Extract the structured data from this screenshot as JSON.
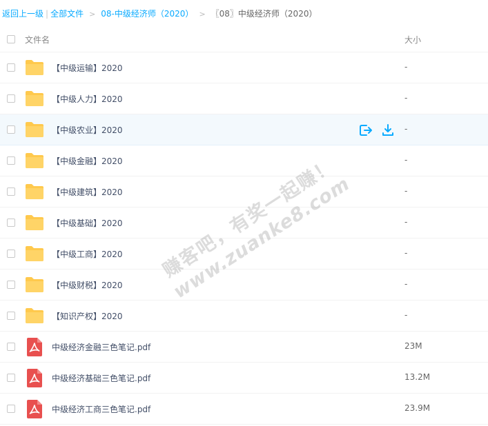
{
  "breadcrumb": {
    "back": "返回上一级",
    "divider": "|",
    "all": "全部文件",
    "folder": "08-中级经济师（2020）",
    "separator": ">",
    "current": "〖08〗中级经济师（2020）"
  },
  "header": {
    "name_label": "文件名",
    "size_label": "大小"
  },
  "files": [
    {
      "name": "【中级运输】2020",
      "size": "-",
      "type": "folder-icon"
    },
    {
      "name": "【中级人力】2020",
      "size": "-",
      "type": "folder-icon"
    },
    {
      "name": "【中级农业】2020",
      "size": "-",
      "type": "folder-icon"
    },
    {
      "name": "【中级金融】2020",
      "size": "-",
      "type": "folder-icon"
    },
    {
      "name": "【中级建筑】2020",
      "size": "-",
      "type": "folder-icon"
    },
    {
      "name": "【中级基础】2020",
      "size": "-",
      "type": "folder-icon"
    },
    {
      "name": "【中级工商】2020",
      "size": "-",
      "type": "folder-icon"
    },
    {
      "name": "【中级财税】2020",
      "size": "-",
      "type": "folder-icon"
    },
    {
      "name": "【知识产权】2020",
      "size": "-",
      "type": "folder-icon"
    },
    {
      "name": "中级经济金融三色笔记.pdf",
      "size": "23M",
      "type": "pdf-icon"
    },
    {
      "name": "中级经济基础三色笔记.pdf",
      "size": "13.2M",
      "type": "pdf-icon"
    },
    {
      "name": "中级经济工商三色笔记.pdf",
      "size": "23.9M",
      "type": "pdf-icon"
    }
  ],
  "hover_row_actions": [
    "share-icon",
    "download-icon"
  ],
  "watermark": {
    "line1": "赚客吧，有奖一起赚！",
    "line2": "www.zuanke8.com"
  },
  "colors": {
    "link": "#09aaff",
    "folder": "#ffc94d",
    "pdf": "#e8504f",
    "hover_row": "#f3f9fd"
  }
}
